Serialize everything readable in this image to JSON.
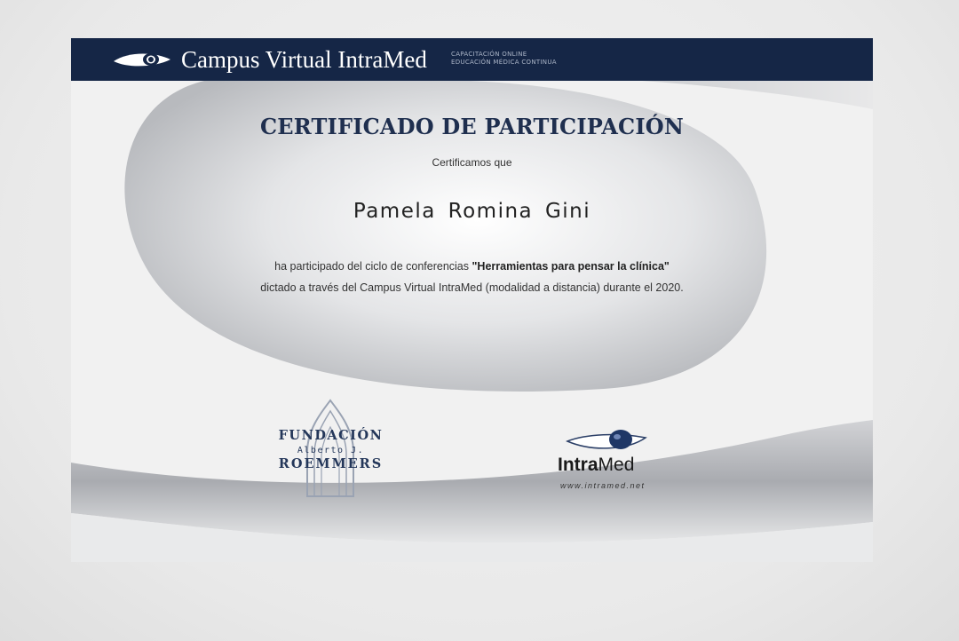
{
  "header": {
    "brand": "Campus Virtual IntraMed",
    "tagline_line1": "CAPACITACIÓN ONLINE",
    "tagline_line2": "EDUCACIÓN MÉDICA CONTINUA",
    "icon": "eye-icon"
  },
  "certificate": {
    "title": "CERTIFICADO DE PARTICIPACIÓN",
    "certify_text": "Certificamos que",
    "recipient": "Pamela Romina Gini",
    "line1_prefix": "ha participado del ciclo de conferencias ",
    "course_name": "\"Herramientas para pensar la clínica\"",
    "line2": "dictado a través del Campus Virtual IntraMed (modalidad a distancia) durante el 2020."
  },
  "logos": {
    "roemmers": {
      "line1": "FUNDACIÓN",
      "line2": "Alberto J.",
      "line3": "ROEMMERS"
    },
    "intramed": {
      "word1": "Intra",
      "word2": "Med",
      "url": "www.intramed.net"
    }
  },
  "colors": {
    "header_bg": "#152646",
    "title": "#1f2f4f",
    "swoosh": "#b9bcc1"
  }
}
